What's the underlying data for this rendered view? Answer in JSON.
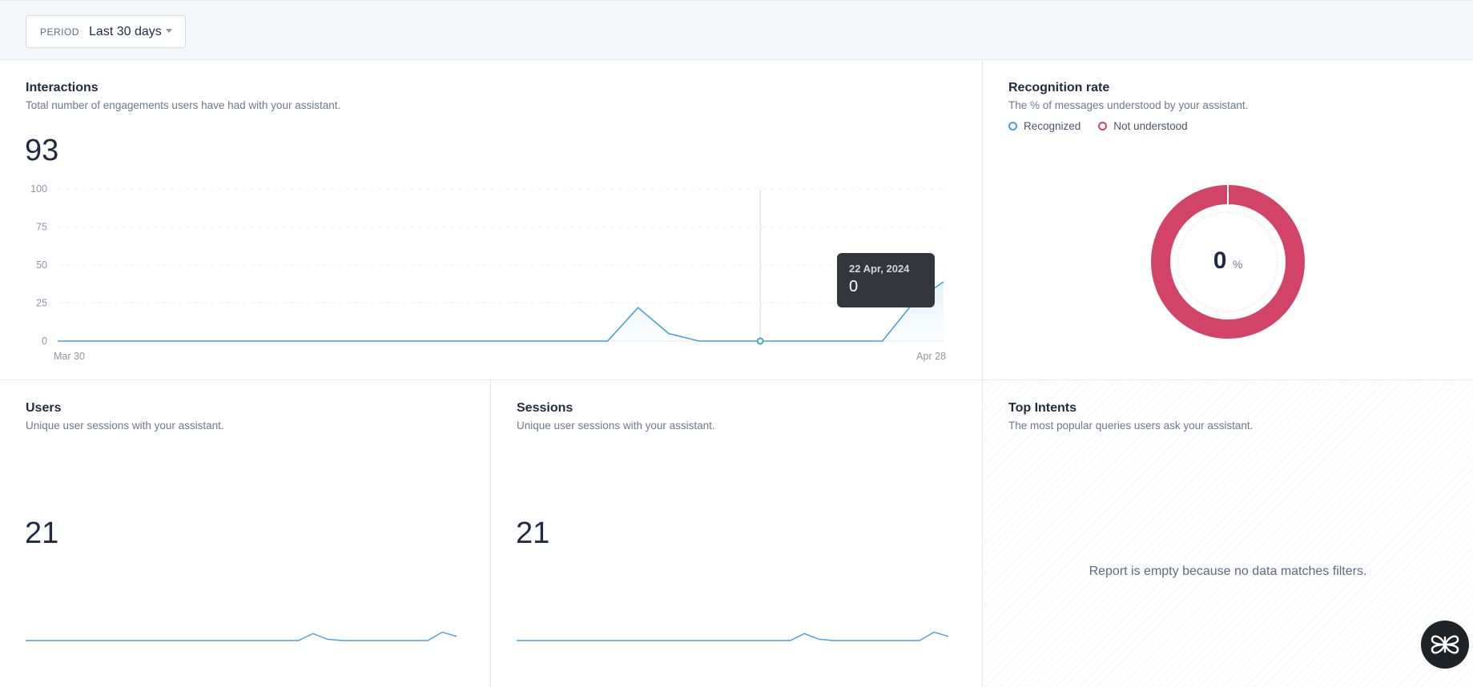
{
  "filter": {
    "label": "PERIOD",
    "value": "Last 30 days"
  },
  "interactions": {
    "title": "Interactions",
    "subtitle": "Total number of engagements users have had with your assistant.",
    "total": "93",
    "tooltip": {
      "date": "22 Apr, 2024",
      "value": "0"
    }
  },
  "recognition": {
    "title": "Recognition rate",
    "subtitle": "The % of messages understood by your assistant.",
    "legend": [
      {
        "label": "Recognized",
        "color": "#4a9fd8"
      },
      {
        "label": "Not understood",
        "color": "#d14468"
      }
    ],
    "value": "0",
    "unit": "%"
  },
  "users": {
    "title": "Users",
    "subtitle": "Unique user sessions with your assistant.",
    "total": "21"
  },
  "sessions": {
    "title": "Sessions",
    "subtitle": "Unique user sessions with your assistant.",
    "total": "21"
  },
  "intents": {
    "title": "Top Intents",
    "subtitle": "The most popular queries users ask your assistant.",
    "empty_message": "Report is empty because no data matches filters."
  },
  "colors": {
    "line": "#4a9fd8",
    "donut": "#d14468",
    "accent_dark": "#1e2328"
  },
  "chart_data": [
    {
      "type": "line",
      "title": "Interactions",
      "x_labels": [
        "Mar 30",
        "Apr 28"
      ],
      "y_ticks": [
        100,
        75,
        50,
        25,
        0
      ],
      "ylim": [
        0,
        100
      ],
      "x": [
        "Mar 30",
        "Mar 31",
        "Apr 1",
        "Apr 2",
        "Apr 3",
        "Apr 4",
        "Apr 5",
        "Apr 6",
        "Apr 7",
        "Apr 8",
        "Apr 9",
        "Apr 10",
        "Apr 11",
        "Apr 12",
        "Apr 13",
        "Apr 14",
        "Apr 15",
        "Apr 16",
        "Apr 17",
        "Apr 18",
        "Apr 19",
        "Apr 20",
        "Apr 21",
        "Apr 22",
        "Apr 23",
        "Apr 24",
        "Apr 25",
        "Apr 26",
        "Apr 27",
        "Apr 28"
      ],
      "values": [
        0,
        0,
        0,
        0,
        0,
        0,
        0,
        0,
        0,
        0,
        0,
        0,
        0,
        0,
        0,
        0,
        0,
        0,
        0,
        22,
        5,
        0,
        0,
        0,
        0,
        0,
        0,
        0,
        25,
        39
      ],
      "grid": true
    },
    {
      "type": "line",
      "title": "Users",
      "values": [
        0,
        0,
        0,
        0,
        0,
        0,
        0,
        0,
        0,
        0,
        0,
        0,
        0,
        0,
        0,
        0,
        0,
        0,
        0,
        0,
        5,
        1,
        0,
        0,
        0,
        0,
        0,
        0,
        0,
        6,
        3
      ]
    },
    {
      "type": "line",
      "title": "Sessions",
      "values": [
        0,
        0,
        0,
        0,
        0,
        0,
        0,
        0,
        0,
        0,
        0,
        0,
        0,
        0,
        0,
        0,
        0,
        0,
        0,
        0,
        5,
        1,
        0,
        0,
        0,
        0,
        0,
        0,
        0,
        6,
        3
      ]
    },
    {
      "type": "pie",
      "title": "Recognition rate",
      "categories": [
        "Recognized",
        "Not understood"
      ],
      "values": [
        0,
        100
      ]
    }
  ]
}
